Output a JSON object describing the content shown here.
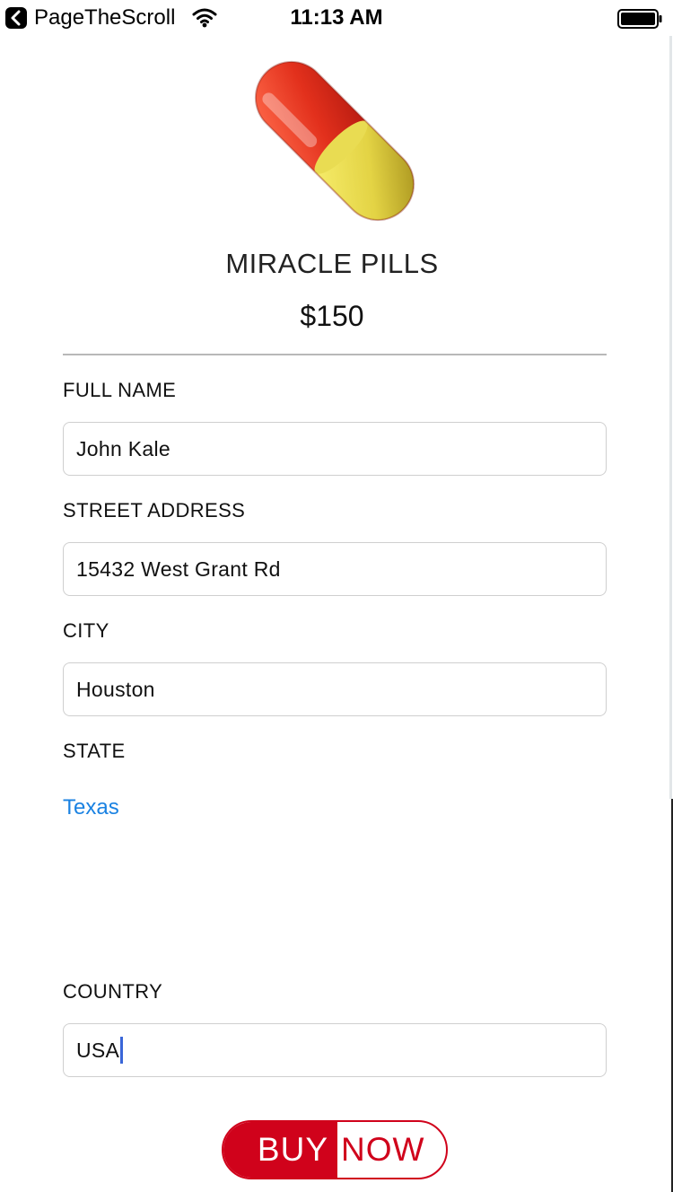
{
  "status_bar": {
    "back_app": "PageTheScroll",
    "time": "11:13 AM"
  },
  "product": {
    "name": "MIRACLE PILLS",
    "price": "$150"
  },
  "form": {
    "full_name_label": "FULL NAME",
    "full_name_value": "John Kale",
    "street_label": "STREET ADDRESS",
    "street_value": "15432 West Grant Rd",
    "city_label": "CITY",
    "city_value": "Houston",
    "state_label": "STATE",
    "state_value": "Texas",
    "country_label": "COUNTRY",
    "country_value": "USA"
  },
  "buy_button": {
    "buy": "BUY",
    "now": "NOW"
  },
  "colors": {
    "accent_red": "#d0021b",
    "link_blue": "#1a82e2",
    "caret_blue": "#3a66d8"
  }
}
